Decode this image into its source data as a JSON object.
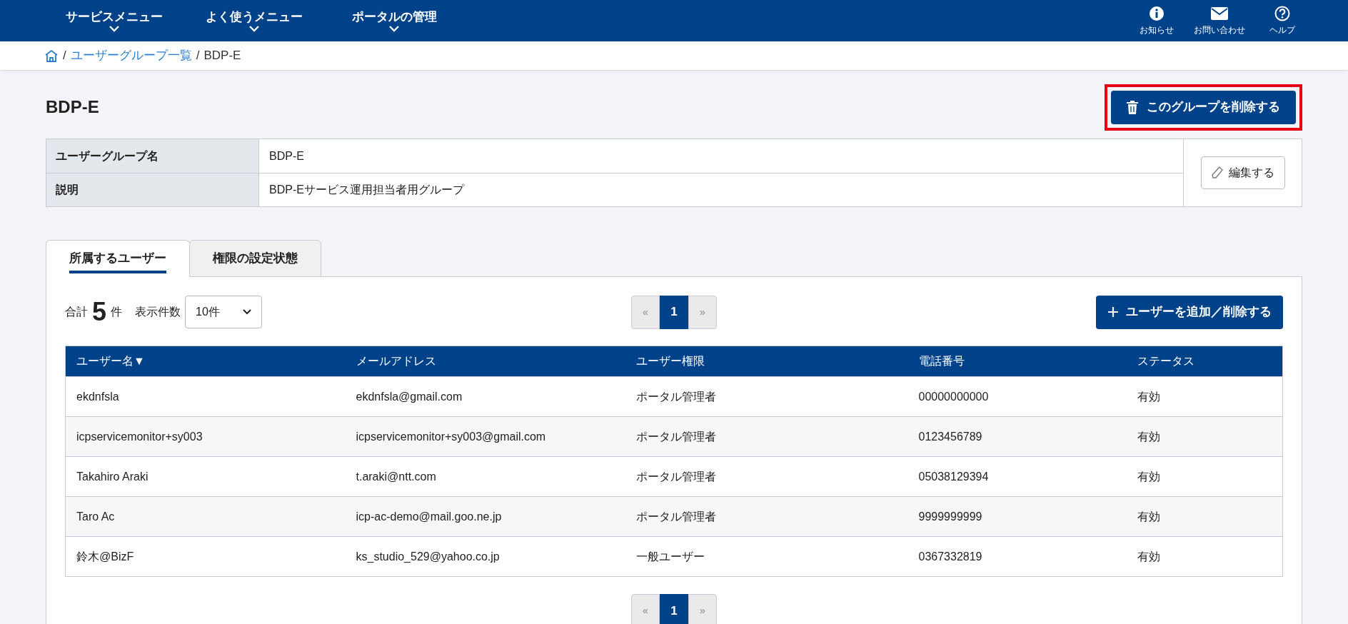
{
  "nav": {
    "menus": [
      {
        "label": "サービスメニュー"
      },
      {
        "label": "よく使うメニュー"
      },
      {
        "label": "ポータルの管理"
      }
    ],
    "utilities": [
      {
        "kind": "info",
        "label": "お知らせ"
      },
      {
        "kind": "mail",
        "label": "お問い合わせ"
      },
      {
        "kind": "help",
        "label": "ヘルプ"
      }
    ]
  },
  "breadcrumb": {
    "separator": "/",
    "links": [
      "ユーザーグループ一覧"
    ],
    "current": "BDP-E"
  },
  "page_title": "BDP-E",
  "delete_button": {
    "label": "このグループを削除する",
    "highlighted": true
  },
  "details": [
    {
      "label": "ユーザーグループ名",
      "value": "BDP-E"
    },
    {
      "label": "説明",
      "value": "BDP-Eサービス運用担当者用グループ"
    }
  ],
  "edit_button": "編集する",
  "tabs": [
    {
      "label": "所属するユーザー",
      "selected": true
    },
    {
      "label": "権限の設定状態",
      "selected": false
    }
  ],
  "summary": {
    "prefix": "合計",
    "count": "5",
    "suffix": "件",
    "page_size_label": "表示件数",
    "page_size": "10件"
  },
  "pagination_top": [
    {
      "label": "«",
      "kind": "prev",
      "selected": false
    },
    {
      "label": "1",
      "kind": "page",
      "selected": true
    },
    {
      "label": "»",
      "kind": "next",
      "selected": false
    }
  ],
  "add_button": "ユーザーを追加／削除する",
  "table": {
    "columns": [
      "ユーザー名▼",
      "メールアドレス",
      "ユーザー権限",
      "電話番号",
      "ステータス"
    ],
    "rows": [
      [
        "ekdnfsla",
        "ekdnfsla@gmail.com",
        "ポータル管理者",
        "00000000000",
        "有効"
      ],
      [
        "icpservicemonitor+sy003",
        "icpservicemonitor+sy003@gmail.com",
        "ポータル管理者",
        "0123456789",
        "有効"
      ],
      [
        "Takahiro Araki",
        "t.araki@ntt.com",
        "ポータル管理者",
        "05038129394",
        "有効"
      ],
      [
        "Taro Ac",
        "icp-ac-demo@mail.goo.ne.jp",
        "ポータル管理者",
        "9999999999",
        "有効"
      ],
      [
        "鈴木@BizF",
        "ks_studio_529@yahoo.co.jp",
        "一般ユーザー",
        "0367332819",
        "有効"
      ]
    ]
  },
  "pagination_bottom": [
    {
      "label": "«",
      "kind": "prev",
      "selected": false
    },
    {
      "label": "1",
      "kind": "page",
      "selected": true
    },
    {
      "label": "»",
      "kind": "next",
      "selected": false
    }
  ]
}
